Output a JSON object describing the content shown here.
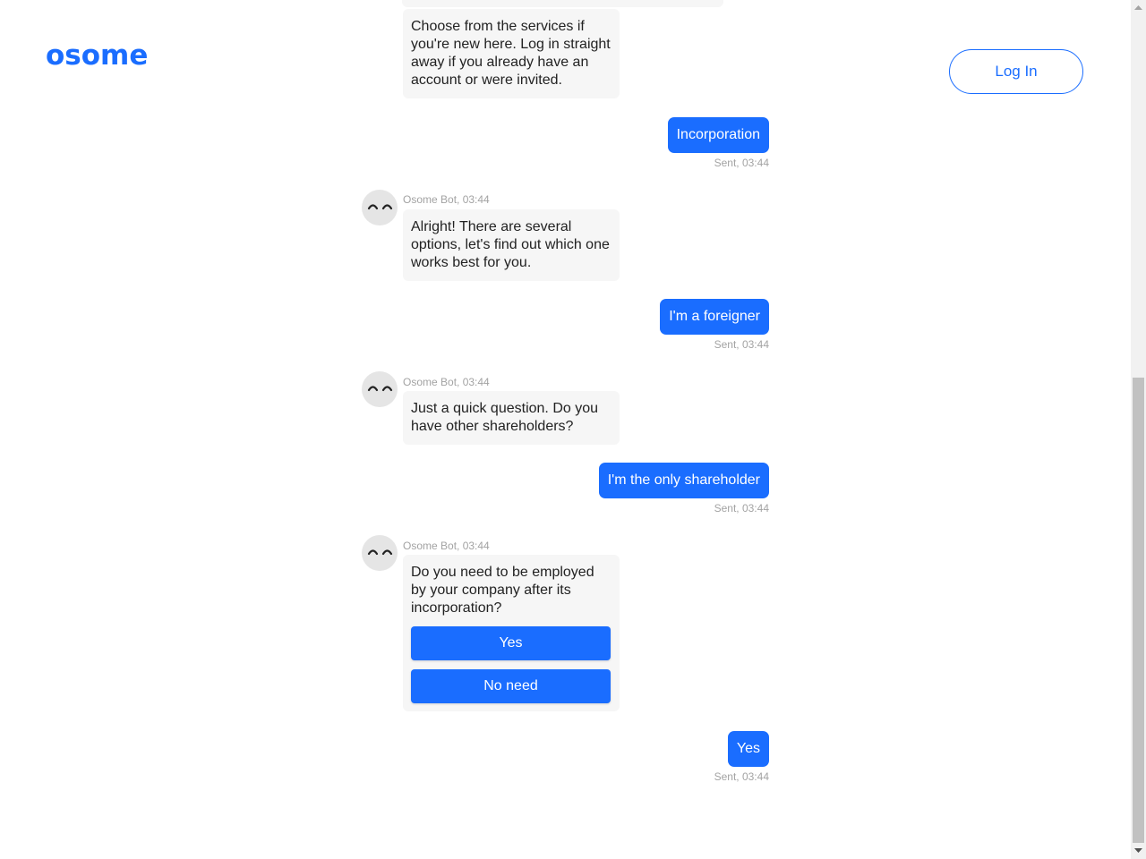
{
  "brand": {
    "logo_text": "osome",
    "accent": "#1a6dff"
  },
  "header": {
    "login_label": "Log In"
  },
  "chat": {
    "messages": [
      {
        "from": "bot",
        "text": "Choose from the services if you're new here. Log in straight away if you already have an account or were invited."
      },
      {
        "from": "user",
        "text": "Incorporation",
        "status": "Sent, 03:44"
      },
      {
        "from": "bot",
        "meta": "Osome Bot, 03:44",
        "text": "Alright! There are several options, let's find out which one works best for you."
      },
      {
        "from": "user",
        "text": "I'm a foreigner",
        "status": "Sent, 03:44"
      },
      {
        "from": "bot",
        "meta": "Osome Bot, 03:44",
        "text": "Just a quick question. Do you have other shareholders?"
      },
      {
        "from": "user",
        "text": "I'm the only shareholder",
        "status": "Sent, 03:44"
      },
      {
        "from": "bot",
        "meta": "Osome Bot, 03:44",
        "text": "Do you need to be employed by your company after its incorporation?",
        "options": [
          "Yes",
          "No need"
        ]
      },
      {
        "from": "user",
        "text": "Yes",
        "status": "Sent, 03:44"
      }
    ]
  },
  "icons": {
    "avatar": "bot-face-icon",
    "scroll_up": "arrow-up-icon",
    "scroll_down": "arrow-down-icon"
  }
}
